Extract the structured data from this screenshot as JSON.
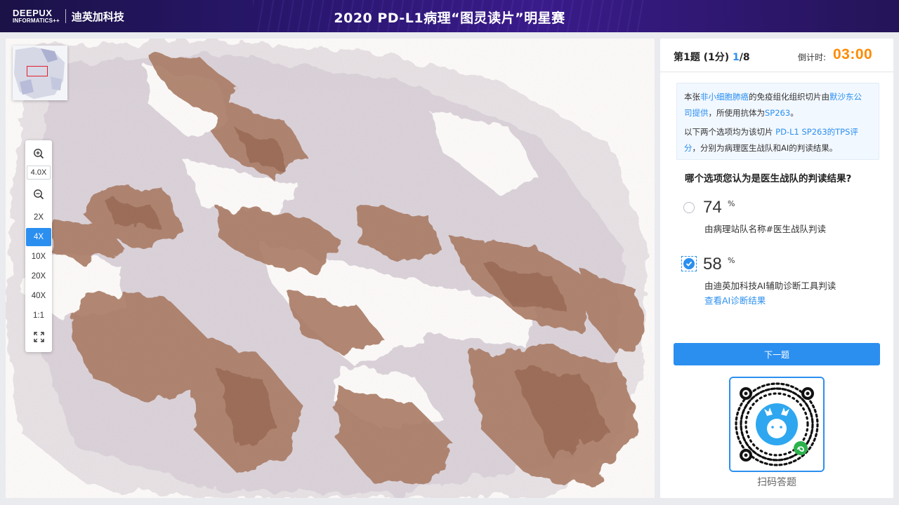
{
  "header": {
    "logo_line1": "DEEPUX",
    "logo_line2": "INFORMATICS++",
    "logo_cn": "迪英加科技",
    "title": "2020 PD-L1病理“图灵读片”明星赛"
  },
  "viewer": {
    "zoom_level": "4.0X",
    "zoom_presets": [
      "2X",
      "4X",
      "10X",
      "20X",
      "40X",
      "1:1"
    ],
    "active_preset": "4X",
    "icons": [
      "zoom-in-icon",
      "zoom-out-icon",
      "fullscreen-icon"
    ]
  },
  "question_header": {
    "label": "第1题 (1分)",
    "current": "1",
    "total": "/8",
    "timer_label": "倒计时:",
    "timer": "03:00"
  },
  "info": {
    "p1_a": "本张",
    "p1_hl1": "非小细胞肺癌",
    "p1_b": "的免疫组化组织切片由",
    "p1_hl2": "默沙东公",
    "p1_hl2b": "司提供",
    "p1_c": "，所使用抗体为",
    "p1_hl3": "SP263",
    "p1_d": "。",
    "p2_a": "以下两个选项均为该切片 ",
    "p2_hl": "PD-L1  SP263的TPS评",
    "p2_hlb": "分",
    "p2_b": "，分别为病理医生战队和AI的判读结果。"
  },
  "question": "哪个选项您认为是医生战队的判读结果?",
  "options": [
    {
      "value": "74",
      "unit": "%",
      "desc": "由病理站队名称#医生战队判读",
      "checked": false
    },
    {
      "value": "58",
      "unit": "%",
      "desc": "由迪英加科技AI辅助诊断工具判读",
      "link": "查看AI诊断结果",
      "checked": true
    }
  ],
  "next_button": "下一题",
  "qr_caption": "扫码答题",
  "colors": {
    "accent": "#2b8ff0",
    "timer": "#ff8a00",
    "header_dark": "#1b1247"
  }
}
